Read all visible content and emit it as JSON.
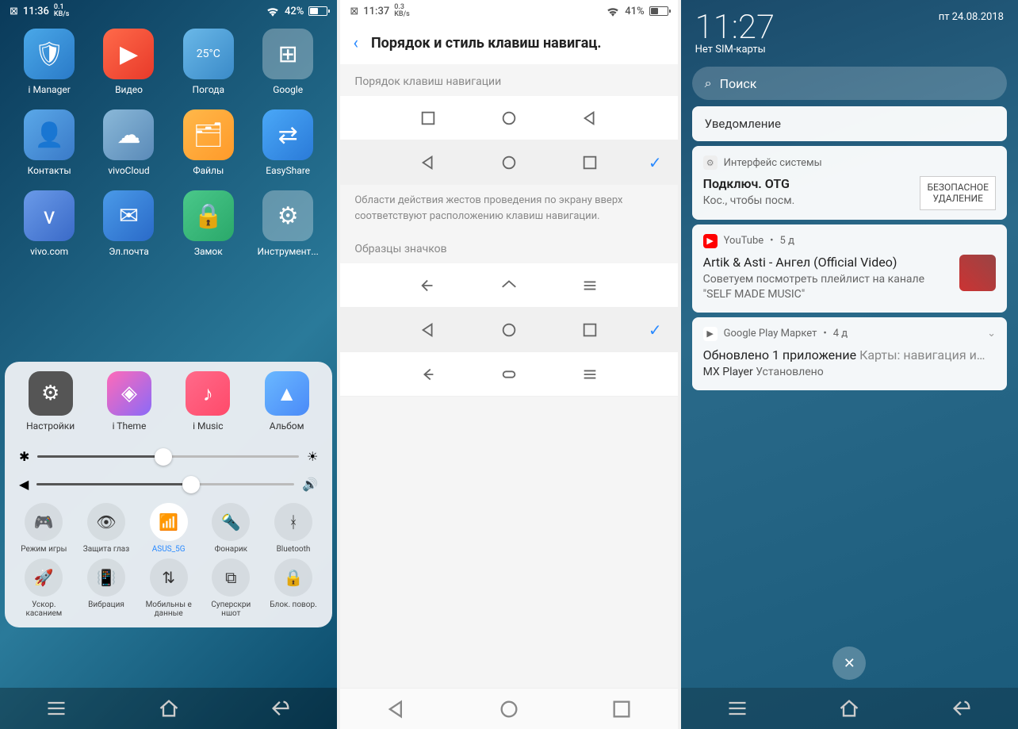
{
  "p1": {
    "status": {
      "time": "11:36",
      "speed_top": "0.1",
      "speed_bot": "KB/s",
      "battery": "42%",
      "battery_fill": 42
    },
    "apps": [
      {
        "label": "i Manager",
        "bg": "linear-gradient(135deg,#4aa8e8,#2a7ac8)",
        "glyph": "🛡"
      },
      {
        "label": "Видео",
        "bg": "linear-gradient(135deg,#ff6a4a,#e83a2a)",
        "glyph": "▶"
      },
      {
        "label": "Погода",
        "bg": "linear-gradient(135deg,#6ab8e8,#3a8ac8)",
        "glyph": "25°C"
      },
      {
        "label": "Google",
        "bg": "rgba(255,255,255,0.3)",
        "glyph": "⊞"
      },
      {
        "label": "Контакты",
        "bg": "linear-gradient(135deg,#5aa8e8,#3a7ac8)",
        "glyph": "👤"
      },
      {
        "label": "vivoCloud",
        "bg": "linear-gradient(135deg,#8ab8d8,#5a8ab8)",
        "glyph": "☁"
      },
      {
        "label": "Файлы",
        "bg": "linear-gradient(135deg,#ffb84a,#ff9a2a)",
        "glyph": "🗂"
      },
      {
        "label": "EasyShare",
        "bg": "linear-gradient(135deg,#4aa8f8,#2a7ad8)",
        "glyph": "⇄"
      },
      {
        "label": "vivo.com",
        "bg": "linear-gradient(135deg,#6a9ae8,#3a6ac8)",
        "glyph": "v"
      },
      {
        "label": "Эл.почта",
        "bg": "linear-gradient(135deg,#4a9ae8,#2a6ac8)",
        "glyph": "✉"
      },
      {
        "label": "Замок",
        "bg": "linear-gradient(135deg,#4ac88a,#2aa86a)",
        "glyph": "🔒"
      },
      {
        "label": "Инструмент...",
        "bg": "rgba(255,255,255,0.3)",
        "glyph": "⚙"
      }
    ],
    "cc_apps": [
      {
        "label": "Настройки",
        "bg": "#555",
        "glyph": "⚙"
      },
      {
        "label": "i Theme",
        "bg": "linear-gradient(135deg,#ff6ab8,#8a6af8)",
        "glyph": "◈"
      },
      {
        "label": "i Music",
        "bg": "linear-gradient(135deg,#ff6a8a,#ff4a6a)",
        "glyph": "♪"
      },
      {
        "label": "Альбом",
        "bg": "linear-gradient(135deg,#6ab8ff,#4a8af8)",
        "glyph": "▲"
      }
    ],
    "sliders": {
      "brightness": 48,
      "volume": 60
    },
    "toggles_row1": [
      {
        "label": "Режим игры",
        "glyph": "🎮"
      },
      {
        "label": "Защита глаз",
        "glyph": "👁"
      },
      {
        "label": "ASUS_5G",
        "glyph": "📶",
        "active": true
      },
      {
        "label": "Фонарик",
        "glyph": "🔦"
      },
      {
        "label": "Bluetooth",
        "glyph": "ᚼ"
      }
    ],
    "toggles_row2": [
      {
        "label": "Ускор. касанием",
        "glyph": "🚀"
      },
      {
        "label": "Вибрация",
        "glyph": "📳"
      },
      {
        "label": "Мобильны е данные",
        "glyph": "⇅"
      },
      {
        "label": "Суперскри ншот",
        "glyph": "⧉"
      },
      {
        "label": "Блок. повор.",
        "glyph": "🔒"
      }
    ]
  },
  "p2": {
    "status": {
      "time": "11:37",
      "speed_top": "0.3",
      "speed_bot": "KB/s",
      "battery": "41%",
      "battery_fill": 41
    },
    "title": "Порядок и стиль клавиш навигац.",
    "section1": "Порядок клавиш навигации",
    "desc": "Области действия жестов проведения по экрану вверх соответствуют расположению клавиш навигации.",
    "section2": "Образцы значков"
  },
  "p3": {
    "time": "11:27",
    "date": "пт 24.08.2018",
    "sim": "Нет SIM-карты",
    "search": "Поиск",
    "notif_header": "Уведомление",
    "n1": {
      "app": "Интерфейс системы",
      "title": "Подключ. OTG",
      "body": "Кос., чтобы посм.",
      "action1": "БЕЗОПАСНОЕ",
      "action2": "УДАЛЕНИЕ"
    },
    "n2": {
      "app": "YouTube",
      "age": "5 д",
      "title": "Artik & Asti - Ангел (Official Video)",
      "body": "Советуем посмотреть плейлист на канале \"SELF MADE MUSIC\""
    },
    "n3": {
      "app": "Google Play Маркет",
      "age": "4 д",
      "title_a": "Обновлено 1 приложение",
      "title_b": "Карты: навигация и…",
      "sub_a": "MX Player",
      "sub_b": "Установлено"
    }
  }
}
